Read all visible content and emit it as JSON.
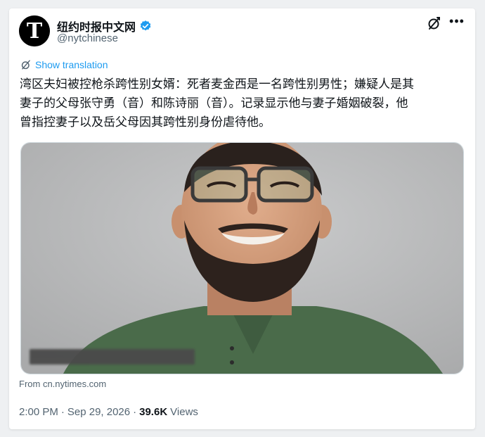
{
  "tweet": {
    "display_name": "纽约时报中文网",
    "handle": "@nytchinese",
    "verified_icon": "verified-badge-icon",
    "translate_label": "Show translation",
    "text": "湾区夫妇被控枪杀跨性别女婿：死者麦金西是一名跨性别男性；嫌疑人是其\n妻子的父母张守勇（音）和陈诗丽（音）。记录显示他与妻子婚姻破裂，他\n曾指控妻子以及岳父母因其跨性别身份虐待他。",
    "source": "From cn.nytimes.com",
    "time": "2:00 PM",
    "date": "Sep 29, 2026",
    "separator": "·",
    "views_count": "39.6K",
    "views_label": "Views"
  },
  "colors": {
    "accent": "#1d9bf0",
    "text": "#0f1419",
    "secondary": "#536471"
  }
}
